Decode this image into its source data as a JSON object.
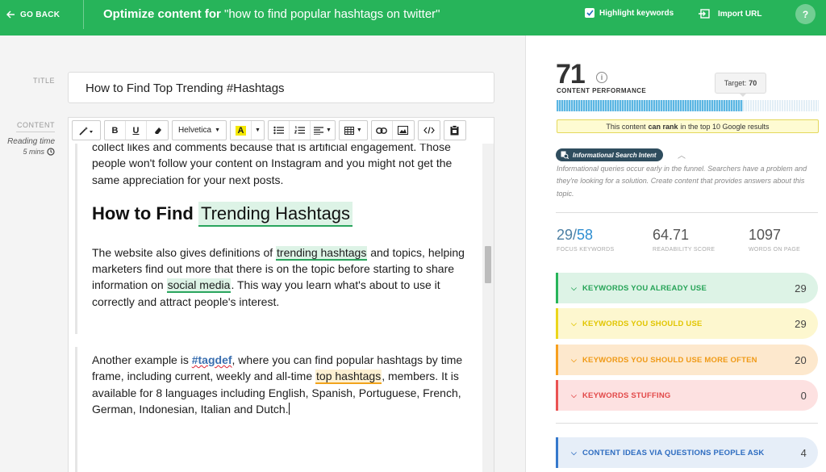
{
  "topbar": {
    "back_label": "GO BACK",
    "title_prefix": "Optimize content for",
    "title_query": "\"how to find popular hashtags on twitter\"",
    "highlight_label": "Highlight keywords",
    "highlight_checked": true,
    "import_label": "Import URL",
    "help_label": "?"
  },
  "editor": {
    "title_label": "TITLE",
    "title_value": "How to Find Top Trending #Hashtags",
    "content_label": "CONTENT",
    "reading_time_label": "Reading time",
    "reading_time_value": "5 mins",
    "toolbar": {
      "bold": "B",
      "underline": "U",
      "font": "Helvetica",
      "highlight": "A"
    },
    "para1": "collect likes and comments because that is artificial engagement. Those people won't follow your content on Instagram and you might not get the same appreciation for your next posts.",
    "heading": {
      "prefix": "How to Find ",
      "keyword": "Trending Hashtags"
    },
    "para2": {
      "a": "The website also gives definitions of ",
      "kw1": "trending hashtags",
      "b": " and topics, helping marketers find out more that there is on the topic before starting to share information on ",
      "kw2": "social media",
      "c": ". This way you learn what's about to use it correctly and attract people's interest."
    },
    "para3": {
      "a": "Another example is ",
      "link": "#tagdef",
      "b": ", where you can find popular hashtags by time frame, including current, weekly and all-time ",
      "kw": "top hashtags",
      "c": ", members. It is available for 8 languages including English, Spanish, Portuguese, French, German, Indonesian, Italian and Dutch."
    }
  },
  "panel": {
    "score": "71",
    "performance_label": "CONTENT PERFORMANCE",
    "target_label": "Target:",
    "target_value": "70",
    "progress": 0.71,
    "rank_prefix": "This content",
    "rank_bold": "can rank",
    "rank_suffix": "in the top 10 Google results",
    "intent_label": "Informational Search Intent",
    "intent_desc": "Informational queries occur early in the funnel. Searchers have a problem and they're looking for a solution. Create content that provides answers about this topic.",
    "stats": {
      "focus_used": "29",
      "focus_total": "58",
      "focus_label": "FOCUS KEYWORDS",
      "readability": "64.71",
      "readability_label": "READABILITY SCORE",
      "words": "1097",
      "words_label": "WORDS ON PAGE"
    },
    "keyword_groups": [
      {
        "label": "KEYWORDS YOU ALREADY USE",
        "count": "29",
        "color": "#27b45a"
      },
      {
        "label": "KEYWORDS YOU SHOULD USE",
        "count": "29",
        "color": "#ecd61b"
      },
      {
        "label": "KEYWORDS YOU SHOULD USE MORE OFTEN",
        "count": "20",
        "color": "#f7a01e"
      },
      {
        "label": "KEYWORDS STUFFING",
        "count": "0",
        "color": "#ea5252"
      },
      {
        "label": "CONTENT IDEAS VIA QUESTIONS PEOPLE ASK",
        "count": "4",
        "color": "#3578cc"
      }
    ]
  }
}
